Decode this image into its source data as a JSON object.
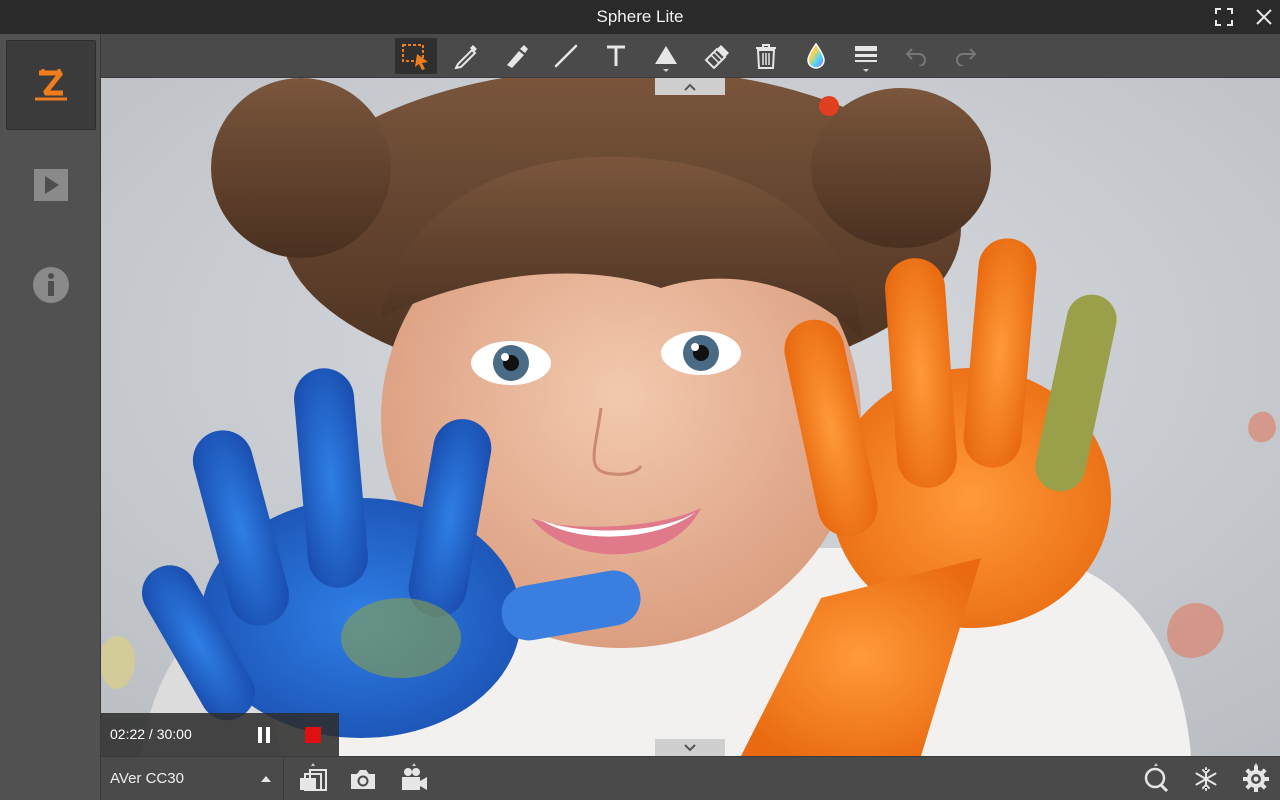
{
  "window": {
    "title": "Sphere Lite"
  },
  "sidebar": {
    "items": [
      {
        "name": "logo-z-icon"
      },
      {
        "name": "play-icon"
      },
      {
        "name": "info-icon"
      }
    ]
  },
  "toolbar": {
    "tools": [
      {
        "name": "select-region-icon",
        "active": true
      },
      {
        "name": "pen-icon"
      },
      {
        "name": "highlighter-icon"
      },
      {
        "name": "line-icon"
      },
      {
        "name": "text-icon"
      },
      {
        "name": "shape-icon"
      },
      {
        "name": "eraser-icon"
      },
      {
        "name": "trash-icon"
      },
      {
        "name": "color-drop-icon"
      },
      {
        "name": "line-width-icon"
      },
      {
        "name": "undo-icon"
      },
      {
        "name": "redo-icon"
      }
    ]
  },
  "recording": {
    "time": "02:22 / 30:00"
  },
  "bottombar": {
    "camera_name": "AVer CC30"
  },
  "colors": {
    "accent": "#f07c1e",
    "record": "#e01010"
  }
}
